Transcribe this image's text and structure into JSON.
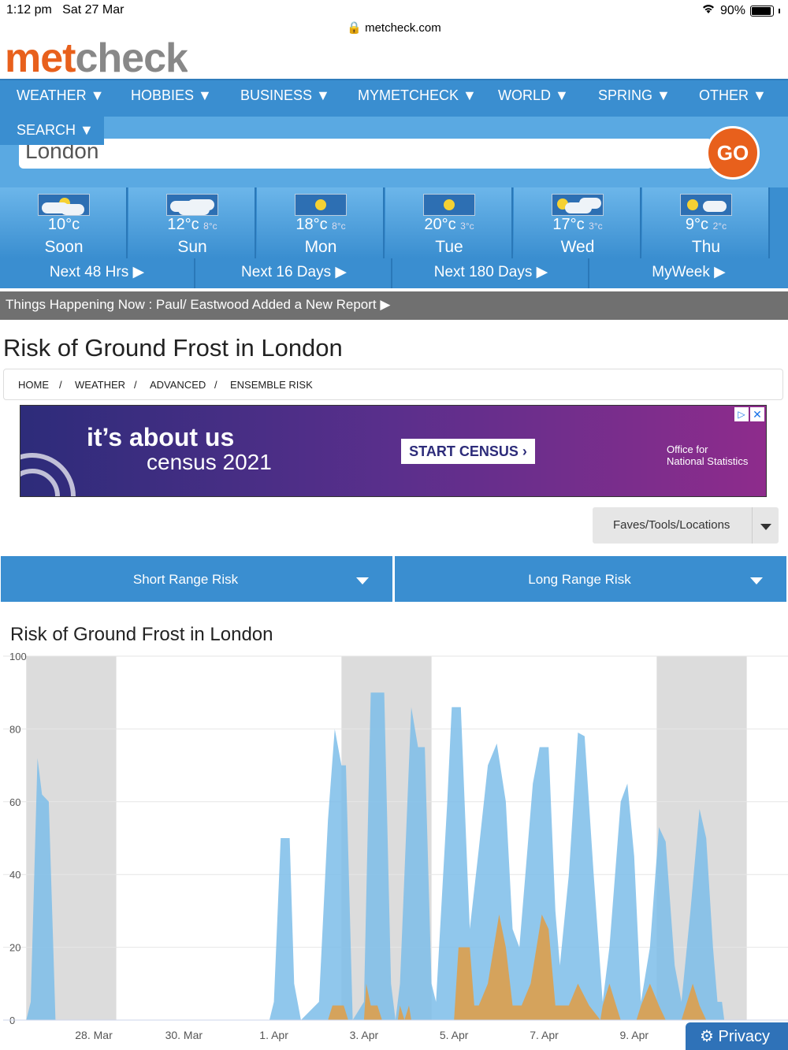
{
  "status": {
    "time": "1:12 pm",
    "date": "Sat 27 Mar",
    "battery": "90%",
    "url": "metcheck.com"
  },
  "logo": {
    "part1": "met",
    "part2": "check"
  },
  "nav": [
    "WEATHER ▼",
    "HOBBIES ▼",
    "BUSINESS ▼",
    "MYMETCHECK ▼",
    "WORLD ▼",
    "SPRING ▼",
    "OTHER ▼"
  ],
  "search": {
    "label": "SEARCH ▼",
    "value": "London",
    "go": "GO"
  },
  "days": [
    {
      "temp": "10°c",
      "low": "",
      "name": "Soon",
      "icon": "partly-cloudy-icon"
    },
    {
      "temp": "12°c",
      "low": "8°c",
      "name": "Sun",
      "icon": "cloudy-icon"
    },
    {
      "temp": "18°c",
      "low": "8°c",
      "name": "Mon",
      "icon": "sunny-icon"
    },
    {
      "temp": "20°c",
      "low": "3°c",
      "name": "Tue",
      "icon": "sunny-icon"
    },
    {
      "temp": "17°c",
      "low": "3°c",
      "name": "Wed",
      "icon": "partly-cloudy-icon"
    },
    {
      "temp": "9°c",
      "low": "2°c",
      "name": "Thu",
      "icon": "partly-cloudy-icon"
    }
  ],
  "ranges": [
    "Next 48 Hrs ▶",
    "Next 16 Days ▶",
    "Next 180 Days ▶",
    "MyWeek ▶"
  ],
  "ticker": "Things Happening Now : Paul/ Eastwood Added a New Report ▶",
  "page_title": "Risk of Ground Frost in London",
  "breadcrumb": [
    "HOME",
    "/",
    "WEATHER",
    "/",
    "ADVANCED",
    "/",
    "ENSEMBLE RISK"
  ],
  "ad": {
    "line1": "it’s about us",
    "line2": "census 2021",
    "cta": "START CENSUS ›",
    "org1": "Office for",
    "org2": "National Statistics"
  },
  "faves": "Faves/Tools/Locations",
  "risk_buttons": [
    "Short Range Risk",
    "Long Range Risk"
  ],
  "privacy": "⚙ Privacy",
  "chart_data": {
    "type": "area",
    "title": "Risk of Ground Frost in London",
    "xlabel": "",
    "ylabel": "",
    "ylim": [
      0,
      100
    ],
    "yticks": [
      0,
      20,
      40,
      60,
      80,
      100
    ],
    "x_range": [
      26.5,
      36.5
    ],
    "xticks": [
      {
        "x": 28,
        "label": "28. Mar"
      },
      {
        "x": 30,
        "label": "30. Mar"
      },
      {
        "x": 32,
        "label": "1. Apr"
      },
      {
        "x": 34,
        "label": "3. Apr"
      },
      {
        "x": 36,
        "label": "5. Apr"
      },
      {
        "x": 38,
        "label": "7. Apr"
      },
      {
        "x": 40,
        "label": "9. Apr"
      }
    ],
    "night_bands": [
      [
        26.5,
        28.5
      ],
      [
        33.5,
        35.5
      ],
      [
        40.5,
        42.5
      ]
    ],
    "colors": {
      "series1": "#7cbde9",
      "series2": "#d9a154",
      "band": "#dcdcdc"
    },
    "series": [
      {
        "values": [
          [
            26.5,
            0
          ],
          [
            26.6,
            5
          ],
          [
            26.75,
            72
          ],
          [
            26.85,
            62
          ],
          [
            27.0,
            60
          ],
          [
            27.1,
            20
          ],
          [
            27.15,
            0
          ],
          [
            31.9,
            0
          ],
          [
            32.0,
            5
          ],
          [
            32.15,
            50
          ],
          [
            32.35,
            50
          ],
          [
            32.45,
            10
          ],
          [
            32.6,
            0
          ],
          [
            33.0,
            5
          ],
          [
            33.2,
            55
          ],
          [
            33.35,
            80
          ],
          [
            33.5,
            70
          ],
          [
            33.6,
            70
          ],
          [
            33.75,
            0
          ],
          [
            34.0,
            5
          ],
          [
            34.15,
            90
          ],
          [
            34.45,
            90
          ],
          [
            34.6,
            10
          ],
          [
            34.7,
            0
          ],
          [
            34.8,
            10
          ],
          [
            35.05,
            86
          ],
          [
            35.2,
            75
          ],
          [
            35.35,
            75
          ],
          [
            35.5,
            10
          ],
          [
            35.6,
            5
          ],
          [
            35.85,
            60
          ],
          [
            35.95,
            86
          ],
          [
            36.15,
            86
          ],
          [
            36.3,
            40
          ],
          [
            36.35,
            25
          ],
          [
            36.55,
            47
          ],
          [
            36.75,
            70
          ],
          [
            36.95,
            76
          ],
          [
            37.15,
            60
          ],
          [
            37.3,
            25
          ],
          [
            37.45,
            20
          ],
          [
            37.75,
            65
          ],
          [
            37.9,
            75
          ],
          [
            38.1,
            75
          ],
          [
            38.25,
            30
          ],
          [
            38.35,
            15
          ],
          [
            38.55,
            40
          ],
          [
            38.75,
            79
          ],
          [
            38.9,
            78
          ],
          [
            39.1,
            40
          ],
          [
            39.3,
            5
          ],
          [
            39.45,
            20
          ],
          [
            39.7,
            60
          ],
          [
            39.85,
            65
          ],
          [
            40.0,
            45
          ],
          [
            40.15,
            5
          ],
          [
            40.35,
            20
          ],
          [
            40.55,
            53
          ],
          [
            40.7,
            49
          ],
          [
            40.9,
            15
          ],
          [
            41.05,
            5
          ],
          [
            41.25,
            30
          ],
          [
            41.45,
            58
          ],
          [
            41.6,
            50
          ],
          [
            41.75,
            20
          ],
          [
            41.85,
            5
          ],
          [
            41.95,
            5
          ],
          [
            42.0,
            0
          ]
        ]
      },
      {
        "values": [
          [
            26.5,
            0
          ],
          [
            33.2,
            0
          ],
          [
            33.3,
            4
          ],
          [
            33.55,
            4
          ],
          [
            33.65,
            0
          ],
          [
            34.0,
            0
          ],
          [
            34.05,
            10
          ],
          [
            34.15,
            4
          ],
          [
            34.3,
            4
          ],
          [
            34.4,
            0
          ],
          [
            34.75,
            0
          ],
          [
            34.8,
            4
          ],
          [
            34.9,
            0
          ],
          [
            35.0,
            4
          ],
          [
            35.05,
            0
          ],
          [
            36.0,
            0
          ],
          [
            36.1,
            20
          ],
          [
            36.35,
            20
          ],
          [
            36.45,
            4
          ],
          [
            36.55,
            4
          ],
          [
            36.75,
            10
          ],
          [
            37.0,
            29
          ],
          [
            37.15,
            20
          ],
          [
            37.3,
            4
          ],
          [
            37.5,
            4
          ],
          [
            37.7,
            10
          ],
          [
            37.95,
            29
          ],
          [
            38.1,
            25
          ],
          [
            38.25,
            4
          ],
          [
            38.55,
            4
          ],
          [
            38.75,
            10
          ],
          [
            39.0,
            4
          ],
          [
            39.25,
            0
          ],
          [
            39.3,
            4
          ],
          [
            39.45,
            10
          ],
          [
            39.6,
            4
          ],
          [
            39.7,
            0
          ],
          [
            40.05,
            0
          ],
          [
            40.15,
            4
          ],
          [
            40.35,
            10
          ],
          [
            40.55,
            4
          ],
          [
            40.7,
            0
          ],
          [
            41.05,
            0
          ],
          [
            41.15,
            4
          ],
          [
            41.3,
            10
          ],
          [
            41.45,
            4
          ],
          [
            41.6,
            0
          ],
          [
            42.0,
            0
          ]
        ]
      }
    ]
  }
}
